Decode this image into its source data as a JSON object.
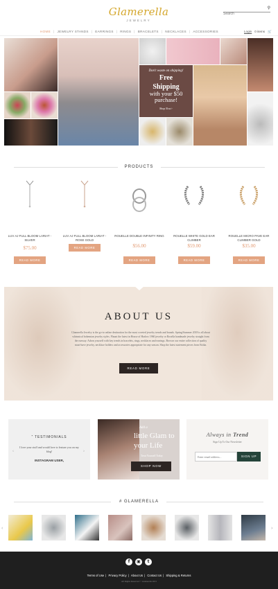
{
  "brand": {
    "name": "Glamerella",
    "sub": "JEWELRY"
  },
  "search": {
    "placeholder": "Search",
    "icon": "search-icon"
  },
  "nav": {
    "items": [
      "HOME",
      "JEWELRY STANDS",
      "EARRINGS",
      "RINGS",
      "BRACELETS",
      "NECKLACES",
      "ACCESSORIES"
    ],
    "login": "Login",
    "cart": "0 items",
    "cart_icon": "cart-icon"
  },
  "promo": {
    "line1": "Don't waste on shipping!",
    "line2a": "Free",
    "line2b": "Shipping",
    "line3a": "with your $50",
    "line3b": "purchase!",
    "cta": "Shop Now>"
  },
  "products": {
    "title": "PRODUCTS",
    "items": [
      {
        "name": "LUV AJ FULL BLOOM LARIAT - SILVER",
        "price": "$75.00",
        "button": "READ MORE"
      },
      {
        "name": "LUV AJ FULL BLOOM LARIAT - ROSE GOLD",
        "price": "",
        "button": "READ MORE"
      },
      {
        "name": "ROUELLE DOUBLE INFINITY RING",
        "price": "$56.00",
        "button": "READ MORE"
      },
      {
        "name": "ROUELLE WHITE GOLD EAR CLIMBER",
        "price": "$59.00",
        "button": "READ MORE"
      },
      {
        "name": "ROUELLE MICRO PAVE EAR CLIMBER GOLD",
        "price": "$35.00",
        "button": "READ MORE"
      }
    ]
  },
  "about": {
    "title": "ABOUT US",
    "text": "Glamerella Jewelry is the go-to online destination for the most coveted jewelry trends and brands. Spring/Summer 2018 is all about whimsical bohemian jewelry styles. Flaunt the latest in House of Harlow 1960 jewelry or Rosella handmade jewelry straight from the runway. Adorn yourself with key trends in bracelets, rings, necklaces and earrings. Browse our entire collection of quality must-have jewelry, necklace holders and accessories appropriate for any season. Shop the latest statement pieces from Ettika.",
    "button": "READ MORE"
  },
  "testimonials": {
    "title": "TESTIMONIALS",
    "text": "I love your stuff and would love to feature you on my blog!",
    "author": "INSTAGRAM USER,"
  },
  "glam": {
    "line1": "Add a",
    "line2": "little Glam to",
    "line3": "your Life",
    "line4": "Treat Yourself Today",
    "button": "SHOP NOW"
  },
  "newsletter": {
    "title_a": "Always in ",
    "title_b": "Trend",
    "sub": "Sign Up To Our Newsletter",
    "placeholder": "Enter email address...",
    "button": "SIGN UP"
  },
  "instagram": {
    "title": "# GLAMERELLA"
  },
  "footer": {
    "social": [
      "facebook-icon",
      "instagram-icon",
      "twitter-icon"
    ],
    "links": [
      "Terms of Use",
      "Privacy Policy",
      "About Us",
      "Contact Us",
      "Shipping & Returns"
    ],
    "copyright": "All Rights Reserved © Glamerella 2015"
  },
  "colors": {
    "accent": "#e29a72",
    "gold": "#d4a62a",
    "dark": "#2d2523",
    "green": "#25443a",
    "footer": "#1f1f1f"
  }
}
